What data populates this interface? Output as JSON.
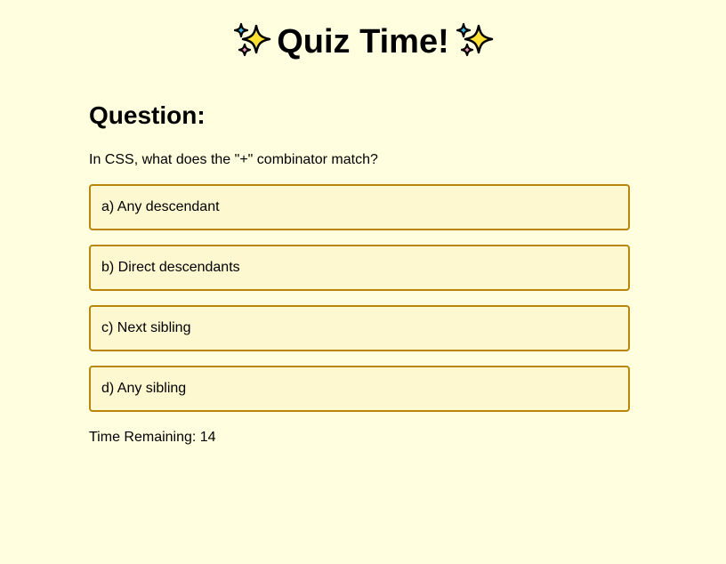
{
  "header": {
    "title": "Quiz Time!",
    "left_icon": "sparkles-icon",
    "right_icon": "sparkles-icon"
  },
  "question": {
    "heading": "Question:",
    "text": "In CSS, what does the \"+\" combinator match?"
  },
  "options": [
    {
      "label": "a) Any descendant"
    },
    {
      "label": "b) Direct descendants"
    },
    {
      "label": "c) Next sibling"
    },
    {
      "label": "d) Any sibling"
    }
  ],
  "timer": {
    "text": "Time Remaining: 14"
  },
  "colors": {
    "background": "#ffffe0",
    "option_background": "#fdf8d0",
    "option_border": "#b8860b",
    "sparkle_yellow": "#ffe135",
    "sparkle_blue": "#3fb8e8",
    "sparkle_pink": "#f49ac1"
  }
}
